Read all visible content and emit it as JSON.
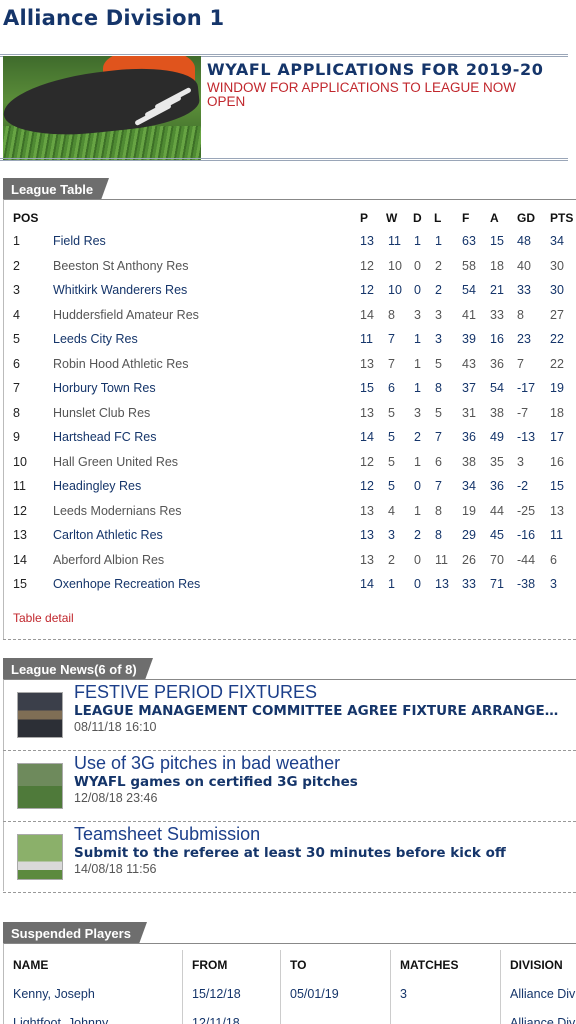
{
  "page_title": "Alliance Division 1",
  "banner": {
    "image": "football-boot-photo",
    "headline": "WYAFL APPLICATIONS FOR 2019-20",
    "subtext": "WINDOW FOR APPLICATIONS TO LEAGUE NOW OPEN"
  },
  "league_table": {
    "header": "League Table",
    "columns": [
      "POS",
      "P",
      "W",
      "D",
      "L",
      "F",
      "A",
      "GD",
      "PTS"
    ],
    "rows": [
      {
        "pos": "1",
        "team": "Field Res",
        "p": "13",
        "w": "11",
        "d": "1",
        "l": "1",
        "f": "63",
        "a": "15",
        "gd": "48",
        "pts": "34"
      },
      {
        "pos": "2",
        "team": "Beeston St Anthony Res",
        "p": "12",
        "w": "10",
        "d": "0",
        "l": "2",
        "f": "58",
        "a": "18",
        "gd": "40",
        "pts": "30"
      },
      {
        "pos": "3",
        "team": "Whitkirk Wanderers Res",
        "p": "12",
        "w": "10",
        "d": "0",
        "l": "2",
        "f": "54",
        "a": "21",
        "gd": "33",
        "pts": "30"
      },
      {
        "pos": "4",
        "team": "Huddersfield Amateur Res",
        "p": "14",
        "w": "8",
        "d": "3",
        "l": "3",
        "f": "41",
        "a": "33",
        "gd": "8",
        "pts": "27"
      },
      {
        "pos": "5",
        "team": "Leeds City Res",
        "p": "11",
        "w": "7",
        "d": "1",
        "l": "3",
        "f": "39",
        "a": "16",
        "gd": "23",
        "pts": "22"
      },
      {
        "pos": "6",
        "team": "Robin Hood Athletic Res",
        "p": "13",
        "w": "7",
        "d": "1",
        "l": "5",
        "f": "43",
        "a": "36",
        "gd": "7",
        "pts": "22"
      },
      {
        "pos": "7",
        "team": "Horbury Town Res",
        "p": "15",
        "w": "6",
        "d": "1",
        "l": "8",
        "f": "37",
        "a": "54",
        "gd": "-17",
        "pts": "19"
      },
      {
        "pos": "8",
        "team": "Hunslet Club Res",
        "p": "13",
        "w": "5",
        "d": "3",
        "l": "5",
        "f": "31",
        "a": "38",
        "gd": "-7",
        "pts": "18"
      },
      {
        "pos": "9",
        "team": "Hartshead FC Res",
        "p": "14",
        "w": "5",
        "d": "2",
        "l": "7",
        "f": "36",
        "a": "49",
        "gd": "-13",
        "pts": "17"
      },
      {
        "pos": "10",
        "team": "Hall Green United Res",
        "p": "12",
        "w": "5",
        "d": "1",
        "l": "6",
        "f": "38",
        "a": "35",
        "gd": "3",
        "pts": "16"
      },
      {
        "pos": "11",
        "team": "Headingley Res",
        "p": "12",
        "w": "5",
        "d": "0",
        "l": "7",
        "f": "34",
        "a": "36",
        "gd": "-2",
        "pts": "15"
      },
      {
        "pos": "12",
        "team": "Leeds Modernians Res",
        "p": "13",
        "w": "4",
        "d": "1",
        "l": "8",
        "f": "19",
        "a": "44",
        "gd": "-25",
        "pts": "13"
      },
      {
        "pos": "13",
        "team": "Carlton Athletic Res",
        "p": "13",
        "w": "3",
        "d": "2",
        "l": "8",
        "f": "29",
        "a": "45",
        "gd": "-16",
        "pts": "11"
      },
      {
        "pos": "14",
        "team": "Aberford Albion Res",
        "p": "13",
        "w": "2",
        "d": "0",
        "l": "11",
        "f": "26",
        "a": "70",
        "gd": "-44",
        "pts": "6"
      },
      {
        "pos": "15",
        "team": "Oxenhope Recreation Res",
        "p": "14",
        "w": "1",
        "d": "0",
        "l": "13",
        "f": "33",
        "a": "71",
        "gd": "-38",
        "pts": "3"
      }
    ],
    "detail_link": "Table detail"
  },
  "league_news": {
    "header": "League News(6 of 8)",
    "items": [
      {
        "title": "FESTIVE PERIOD FIXTURES",
        "summary": "LEAGUE MANAGEMENT COMMITTEE AGREE FIXTURE ARRANGEMENTS",
        "date": "08/11/18 16:10",
        "thumb": "stadium-photo"
      },
      {
        "title": "Use of 3G pitches in bad weather",
        "summary": "WYAFL games on certified 3G pitches",
        "date": "12/08/18 23:46",
        "thumb": "players-photo"
      },
      {
        "title": "Teamsheet Submission",
        "summary": "Submit to the referee at least 30 minutes before kick off",
        "date": "14/08/18 11:56",
        "thumb": "ball-photo"
      }
    ]
  },
  "suspended_players": {
    "header": "Suspended Players",
    "columns": {
      "name": "NAME",
      "from": "FROM",
      "to": "TO",
      "matches": "MATCHES",
      "division": "DIVISION"
    },
    "rows": [
      {
        "name": "Kenny, Joseph",
        "from": "15/12/18",
        "to": "05/01/19",
        "matches": "3",
        "division": "Alliance Div"
      },
      {
        "name": "Lightfoot, Johnny",
        "from": "12/11/18",
        "to": "",
        "matches": "",
        "division": "Alliance Div"
      }
    ]
  }
}
